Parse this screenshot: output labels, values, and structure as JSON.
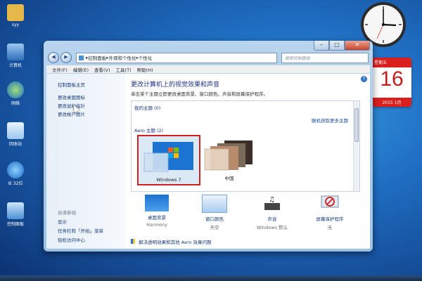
{
  "desktop": {
    "icons": [
      {
        "label": "syy",
        "color": "#e6b84a"
      },
      {
        "label": "计算机",
        "color": "#6aa6e8"
      },
      {
        "label": "网络",
        "color": "#3f90d8"
      },
      {
        "label": "回收站",
        "color": "#9cc7ee"
      },
      {
        "label": "IE 32位",
        "color": "#2b8ae0"
      },
      {
        "label": "控制面板",
        "color": "#5ca6e6"
      }
    ]
  },
  "calendar": {
    "weekday": "星期五",
    "day": "16",
    "year": "2015",
    "month": "1月"
  },
  "window": {
    "nav": {
      "back": "◀",
      "forward": "▶"
    },
    "address": [
      "控制面板",
      "外观和个性化",
      "个性化"
    ],
    "search_placeholder": "搜索控制面板",
    "buttons": {
      "min": "–",
      "max": "□",
      "close": "✕"
    },
    "menu": [
      "文件(F)",
      "编辑(E)",
      "查看(V)",
      "工具(T)",
      "帮助(H)"
    ],
    "left_pane": {
      "links": [
        "控制面板主页",
        "更改桌面图标",
        "更改鼠标指针",
        "更改帐户图片"
      ],
      "see_also_title": "另请参阅",
      "see_also": [
        "显示",
        "任务栏和「开始」菜单",
        "轻松访问中心"
      ]
    },
    "main": {
      "title": "更改计算机上的视觉效果和声音",
      "description": "单击某个主题立即更改桌面背景、窗口颜色、声音和屏幕保护程序。",
      "my_themes": "我的主题 (0)",
      "get_more": "联机获取更多主题",
      "aero_themes": "Aero 主题 (2)",
      "themes": [
        {
          "name": "Windows 7",
          "selected": true
        },
        {
          "name": "中国",
          "selected": false
        }
      ],
      "bottom": [
        {
          "label": "桌面背景",
          "sub": "Harmony"
        },
        {
          "label": "窗口颜色",
          "sub": "天空"
        },
        {
          "label": "声音",
          "sub": "Windows 默认"
        },
        {
          "label": "屏幕保护程序",
          "sub": "无"
        }
      ],
      "aero_link": "解决透明效果和其他 Aero 效果问题"
    }
  }
}
